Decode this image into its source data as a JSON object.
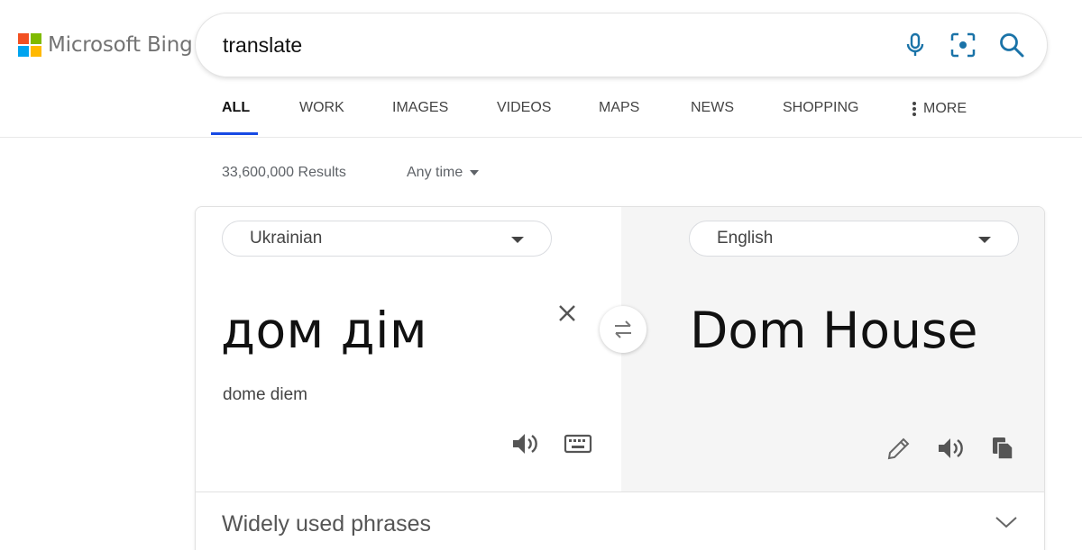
{
  "brand": {
    "name": "Microsoft Bing"
  },
  "search": {
    "query": "translate"
  },
  "icons": {
    "mic": "microphone-icon",
    "visual": "visual-search-icon",
    "search": "search-icon"
  },
  "tabs": [
    {
      "label": "ALL",
      "active": true
    },
    {
      "label": "WORK"
    },
    {
      "label": "IMAGES"
    },
    {
      "label": "VIDEOS"
    },
    {
      "label": "MAPS"
    },
    {
      "label": "NEWS"
    },
    {
      "label": "SHOPPING"
    },
    {
      "label": "MORE"
    }
  ],
  "results": {
    "count": "33,600,000 Results",
    "time_filter": "Any time"
  },
  "translator": {
    "source_language": "Ukrainian",
    "target_language": "English",
    "source_text": "дом дім",
    "transliteration": "dome diem",
    "translation": "Dom House",
    "phrases_label": "Widely used phrases"
  },
  "colors": {
    "accent": "#174ae4",
    "icon_blue": "#1a73a8",
    "icon_gray": "#5f6368"
  }
}
